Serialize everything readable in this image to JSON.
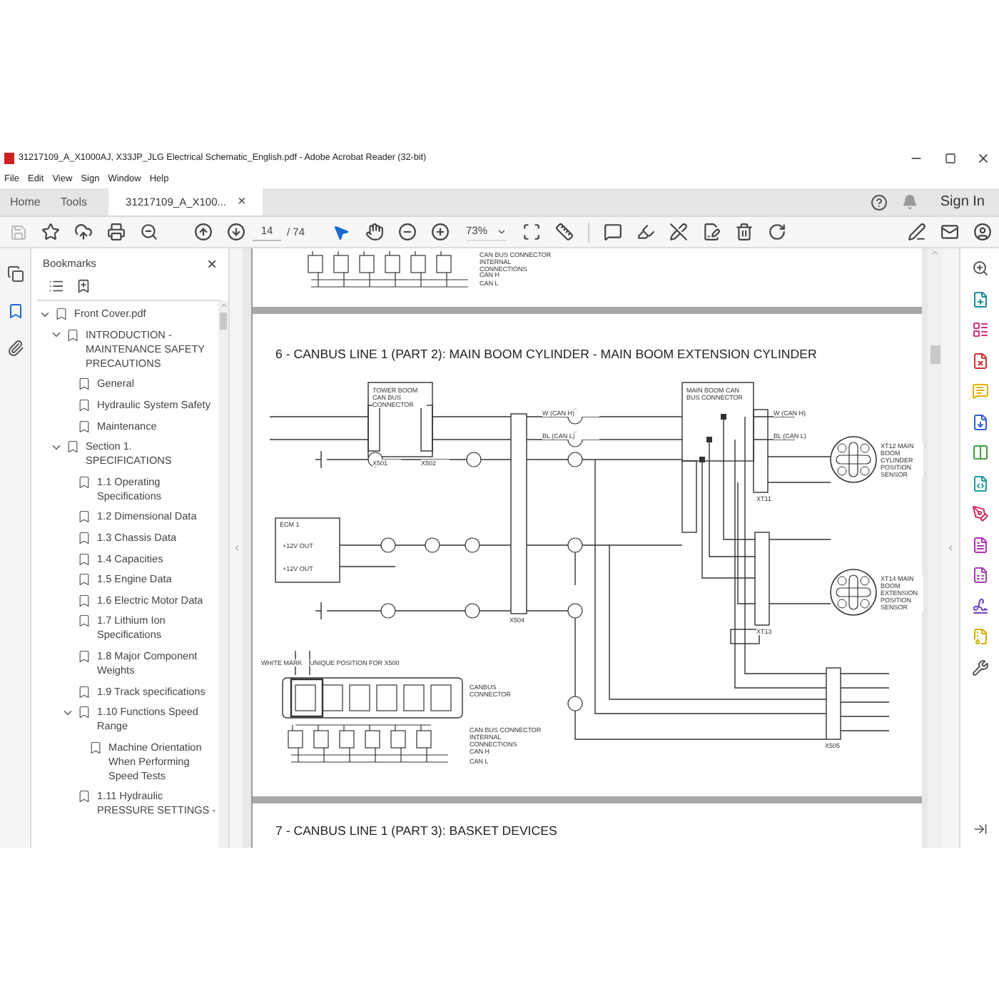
{
  "window": {
    "title": "31217109_A_X1000AJ, X33JP_JLG Electrical Schematic_English.pdf - Adobe Acrobat Reader (32-bit)"
  },
  "menu": [
    "File",
    "Edit",
    "View",
    "Sign",
    "Window",
    "Help"
  ],
  "tabs": [
    {
      "label": "Home",
      "selected": false
    },
    {
      "label": "Tools",
      "selected": false
    },
    {
      "label": "31217109_A_X100...",
      "selected": true,
      "close": "×"
    }
  ],
  "sign_in": "Sign In",
  "toolbar": {
    "page_current": "14",
    "page_total": "/ 74",
    "zoom": "73%"
  },
  "bookmarks": {
    "title": "Bookmarks",
    "close": "×",
    "items": [
      {
        "label": "Front Cover.pdf",
        "expanded": true,
        "children": [
          {
            "label": "INTRODUCTION - MAINTENANCE SAFETY PRECAUTIONS",
            "expanded": true,
            "children": [
              {
                "label": "General"
              },
              {
                "label": "Hydraulic System Safety"
              },
              {
                "label": "Maintenance"
              }
            ]
          },
          {
            "label": "Section 1. SPECIFICATIONS",
            "expanded": true,
            "children": [
              {
                "label": "1.1 Operating Specifications"
              },
              {
                "label": "1.2 Dimensional Data"
              },
              {
                "label": "1.3 Chassis Data"
              },
              {
                "label": "1.4 Capacities"
              },
              {
                "label": "1.5 Engine Data"
              },
              {
                "label": "1.6 Electric Motor Data"
              },
              {
                "label": "1.7 Lithium Ion Specifications"
              },
              {
                "label": "1.8 Major Component Weights"
              },
              {
                "label": "1.9 Track specifications"
              },
              {
                "label": "1.10 Functions Speed Range",
                "expanded": true,
                "children": [
                  {
                    "label": "Machine Orientation When Performing Speed Tests"
                  }
                ]
              },
              {
                "label": "1.11 Hydraulic PRESSURE SETTINGS -"
              }
            ]
          }
        ]
      }
    ]
  },
  "document": {
    "previous_page_labels": [
      "CAN BUS CONNECTOR INTERNAL CONNECTIONS",
      "CAN H",
      "CAN L"
    ],
    "section_title": "6 - CANBUS LINE 1 (PART 2): MAIN BOOM CYLINDER - MAIN BOOM EXTENSION CYLINDER",
    "schematic_labels": [
      "TOWER BOOM CAN BUS CONNECTOR",
      "MAIN BOOM CAN BUS CONNECTOR",
      "W (CAN H)",
      "BL (CAN L)",
      "W (CAN H)",
      "BL (CAN L)",
      "X501",
      "X502",
      "X504",
      "XT11",
      "XT12 MAIN BOOM CYLINDER POSITION SENSOR",
      "XT13",
      "XT14 MAIN BOOM EXTENSION POSITION SENSOR",
      "ECM 1",
      "+12V OUT",
      "+12V OUT",
      "X505",
      "WHITE MARK",
      "UNIQUE POSITION FOR X500",
      "CANBUS CONNECTOR",
      "CAN BUS CONNECTOR INTERNAL CONNECTIONS",
      "CAN H",
      "CAN L"
    ],
    "next_section_title": "7 - CANBUS LINE 1 (PART 3): BASKET DEVICES"
  }
}
